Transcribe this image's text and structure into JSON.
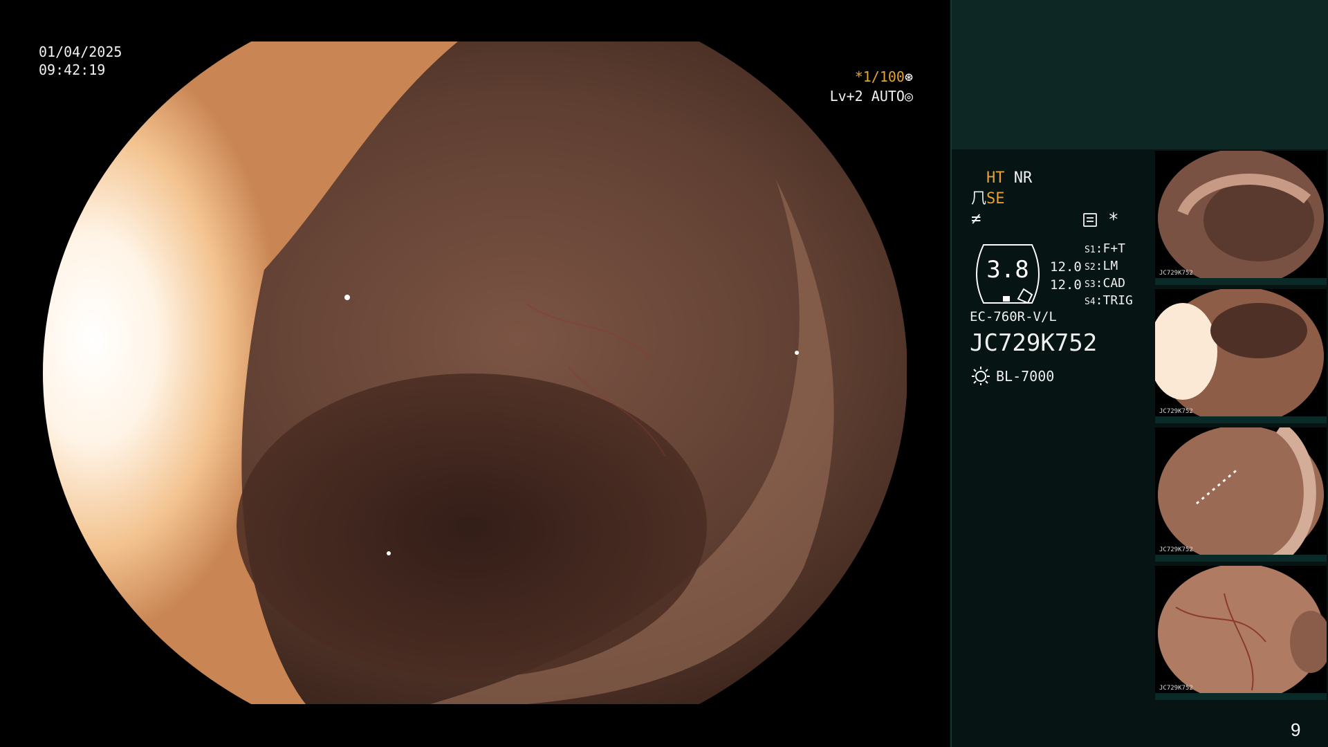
{
  "overlay": {
    "date": "01/04/2025",
    "time": "09:42:19",
    "shutter_ratio": "*1/100",
    "shutter_icon": "aperture-icon",
    "level": "Lv+2",
    "exposure_mode": "AUTO",
    "exposure_icon": "iris-icon"
  },
  "panel": {
    "ht": "HT",
    "nr": "NR",
    "se": "SE",
    "se_icon": "enhance-icon",
    "freq_icon": "not-equal-icon",
    "menu_icon": "menu-icon",
    "star": "*",
    "gauge_value": "3.8",
    "gain_top": "12.0",
    "gain_bottom": "12.0",
    "slots": [
      {
        "key": "S1",
        "value": "F+T"
      },
      {
        "key": "S2",
        "value": "LM"
      },
      {
        "key": "S3",
        "value": "CAD"
      },
      {
        "key": "S4",
        "value": "TRIG"
      }
    ],
    "scope_model": "EC-760R-V/L",
    "serial": "JC729K752",
    "lamp_icon": "light-source-icon",
    "lamp": "BL-7000",
    "page_number": "9"
  },
  "thumbnails": [
    {
      "id": "JC729K752"
    },
    {
      "id": "JC729K752"
    },
    {
      "id": "JC729K752"
    },
    {
      "id": "JC729K752"
    }
  ],
  "colors": {
    "accent_orange": "#e8a22c",
    "panel_bg": "#061413",
    "panel_top_bg": "#0c2724"
  }
}
